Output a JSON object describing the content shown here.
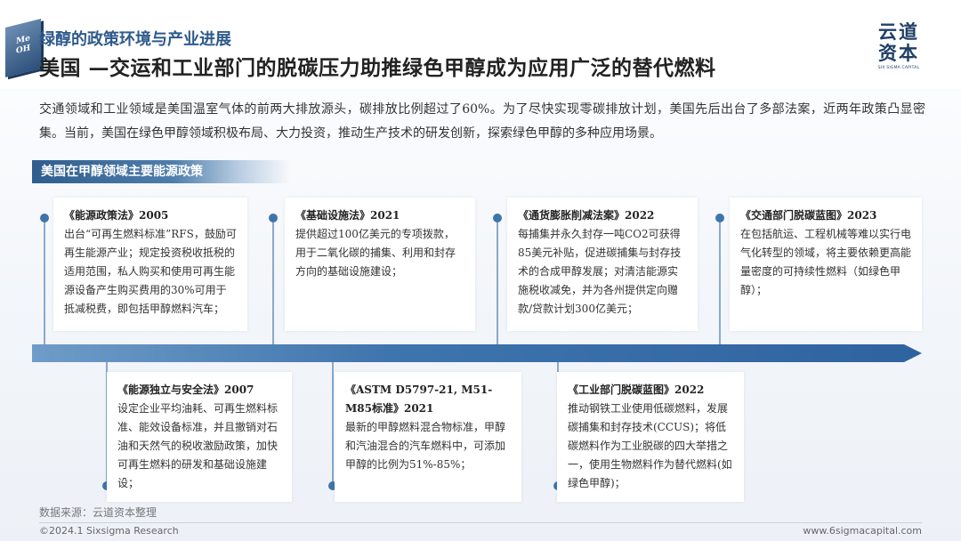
{
  "header": {
    "logo_text": "Me\nOH",
    "subtitle": "绿醇的政策环境与产业进展",
    "title": "美国 —交运和工业部门的脱碳压力助推绿色甲醇成为应用广泛的替代燃料",
    "brand_cn": "云道\n资本",
    "brand_en": "SIX SIGMA CAPITAL"
  },
  "intro": "交通领域和工业领域是美国温室气体的前两大排放源头，碳排放比例超过了60%。为了尽快实现零碳排放计划，美国先后出台了多部法案，近两年政策凸显密集。当前，美国在绿色甲醇领域积极布局、大力投资，推动生产技术的研发创新，探索绿色甲醇的多种应用场景。",
  "section_label": "美国在甲醇领域主要能源政策",
  "top_policies": [
    {
      "title": "《能源政策法》2005",
      "body": "出台“可再生燃料标准”RFS，鼓励可再生能源产业；规定投资税收抵税的适用范围，私人购买和使用可再生能源设备产生购买费用的30%可用于抵减税费，即包括甲醇燃料汽车；"
    },
    {
      "title": "《基础设施法》2021",
      "body": "提供超过100亿美元的专项拨款，用于二氧化碳的捕集、利用和封存方向的基础设施建设；"
    },
    {
      "title": "《通货膨胀削减法案》2022",
      "body": "每捕集并永久封存一吨CO2可获得85美元补贴，促进碳捕集与封存技术的合成甲醇发展；对清洁能源实施税收减免，并为各州提供定向赠款/贷款计划300亿美元；"
    },
    {
      "title": "《交通部门脱碳蓝图》2023",
      "body": "在包括航运、工程机械等难以实行电气化转型的领域，将主要依赖更高能量密度的可持续性燃料（如绿色甲醇）；"
    }
  ],
  "bottom_policies": [
    {
      "title": "《能源独立与安全法》2007",
      "body": "设定企业平均油耗、可再生燃料标准、能效设备标准，并且撤销对石油和天然气的税收激励政策，加快可再生燃料的研发和基础设施建设；"
    },
    {
      "title": "《ASTM D5797-21, M51-M85标准》2021",
      "body": "最新的甲醇燃料混合物标准，甲醇和汽油混合的汽车燃料中，可添加甲醇的比例为51%-85%；"
    },
    {
      "title": "《工业部门脱碳蓝图》2022",
      "body": "推动钢铁工业使用低碳燃料，发展碳捕集和封存技术(CCUS)；将低碳燃料作为工业脱碳的四大举措之一，使用生物燃料作为替代燃料(如绿色甲醇)；"
    }
  ],
  "source": "数据来源：云道资本整理",
  "footer_left": "©2024.1 Sixsigma Research",
  "footer_right": "www.6sigmacapital.com",
  "colors": {
    "accent": "#2e5a8c",
    "timeline": "#3f75ad",
    "dot": "#3f74ab"
  }
}
